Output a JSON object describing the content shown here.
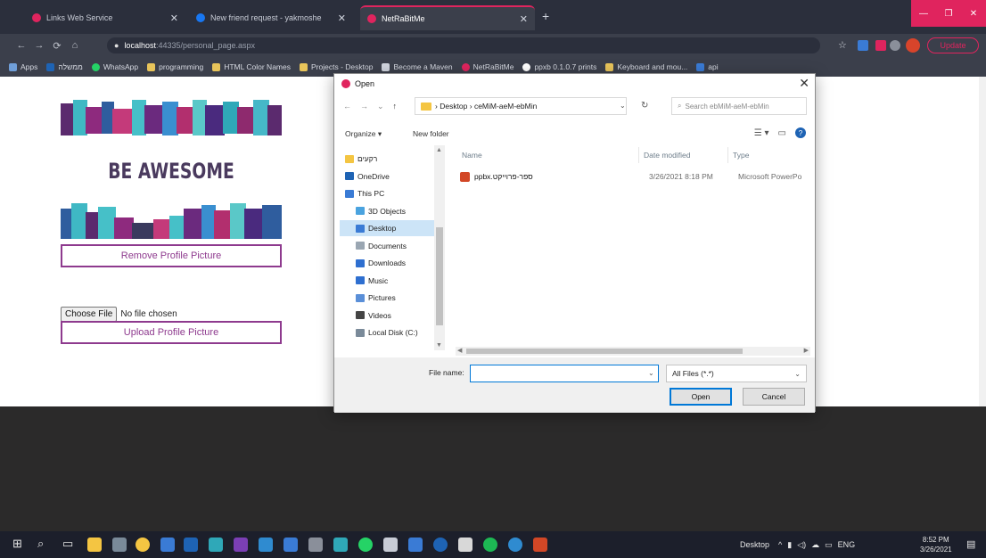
{
  "browser": {
    "tabs": [
      {
        "label": "Links Web Service",
        "color": "#e0245e"
      },
      {
        "label": "New friend request - yakmoshe",
        "color": "#1877f2"
      },
      {
        "label": "NetRaBitMe",
        "color": "#e0245e"
      }
    ],
    "new_tab_glyph": "+",
    "window_buttons": [
      "—",
      "❐",
      "✕"
    ],
    "nav": {
      "back": "←",
      "forward": "→",
      "reload": "⟳",
      "home": "⌂"
    },
    "url_host": "localhost",
    "url_path": ":44335/personal_page.aspx",
    "update_label": "Update",
    "bookmarks": [
      "Apps",
      "ממשלה",
      "WhatsApp",
      "programming",
      "HTML Color Names",
      "Projects - Desktop",
      "Become a Maven",
      "NetRaBitMe",
      "ppxb 0.1.0.7 prints",
      "Keyboard and mou...",
      "api"
    ]
  },
  "page": {
    "headline": "BE AWESOME",
    "remove_button": "Remove Profile Picture",
    "choose_file_button": "Choose File",
    "no_file_text": "No file chosen",
    "upload_button": "Upload Profile Picture"
  },
  "dialog": {
    "title": "Open",
    "close_glyph": "✕",
    "breadcrumb": [
      "Desktop",
      "ceMiM-aeM-ebMin"
    ],
    "search_placeholder": "Search ebMiM-aeM-ebMin",
    "organize_label": "Organize ▾",
    "new_folder_label": "New folder",
    "nav_items": [
      {
        "label": "רקעים",
        "icon": "folder-icon",
        "color": "#f4c542",
        "top": true
      },
      {
        "label": "OneDrive",
        "icon": "cloud-icon",
        "color": "#1e63b4",
        "top": true
      },
      {
        "label": "This PC",
        "icon": "computer-icon",
        "color": "#3a7bd5",
        "top": true
      },
      {
        "label": "3D Objects",
        "icon": "cube-icon",
        "color": "#4aa3df",
        "top": false
      },
      {
        "label": "Desktop",
        "icon": "desktop-icon",
        "color": "#3a7bd5",
        "top": false,
        "selected": true
      },
      {
        "label": "Documents",
        "icon": "document-icon",
        "color": "#9aa6b2",
        "top": false
      },
      {
        "label": "Downloads",
        "icon": "download-icon",
        "color": "#2e6fd0",
        "top": false
      },
      {
        "label": "Music",
        "icon": "music-icon",
        "color": "#2e6fd0",
        "top": false
      },
      {
        "label": "Pictures",
        "icon": "picture-icon",
        "color": "#5a8fd8",
        "top": false
      },
      {
        "label": "Videos",
        "icon": "video-icon",
        "color": "#444444",
        "top": false
      },
      {
        "label": "Local Disk (C:)",
        "icon": "disk-icon",
        "color": "#7a8a99",
        "top": false
      }
    ],
    "columns": [
      "Name",
      "Date modified",
      "Type"
    ],
    "files": [
      {
        "name": "ppbx.ספר-פרוייקט",
        "date": "3/26/2021 8:18 PM",
        "type": "Microsoft PowerPo"
      }
    ],
    "file_name_label": "File name:",
    "file_name_value": "",
    "filter_value": "All Files (*.*)",
    "open_label": "Open",
    "cancel_label": "Cancel"
  },
  "taskbar": {
    "desktop_label": "Desktop",
    "language": "ENG",
    "time": "8:52 PM",
    "date": "3/26/2021"
  }
}
